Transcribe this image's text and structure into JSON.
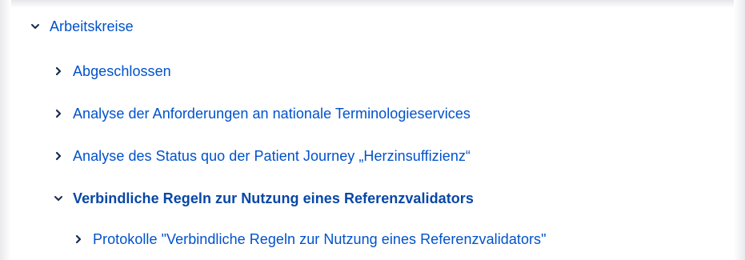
{
  "tree": {
    "root": {
      "label": "Arbeitskreise",
      "expanded": true,
      "icon": "chevron-down-icon",
      "children": [
        {
          "label": "Abgeschlossen",
          "expanded": false,
          "icon": "chevron-right-icon"
        },
        {
          "label": "Analyse der Anforderungen an nationale Terminologieservices",
          "expanded": false,
          "icon": "chevron-right-icon"
        },
        {
          "label": "Analyse des Status quo der Patient Journey „Herzinsuffizienz“",
          "expanded": false,
          "icon": "chevron-right-icon"
        },
        {
          "label": "Verbindliche Regeln zur Nutzung eines Referenzvalidators",
          "expanded": true,
          "current": true,
          "icon": "chevron-down-icon",
          "children": [
            {
              "label": "Protokolle \"Verbindliche Regeln zur Nutzung eines Referenzvalidators\"",
              "expanded": false,
              "icon": "chevron-right-icon"
            }
          ]
        }
      ]
    }
  },
  "colors": {
    "link": "#0052cc",
    "current": "#0747a6",
    "chevron": "#172b4d"
  }
}
